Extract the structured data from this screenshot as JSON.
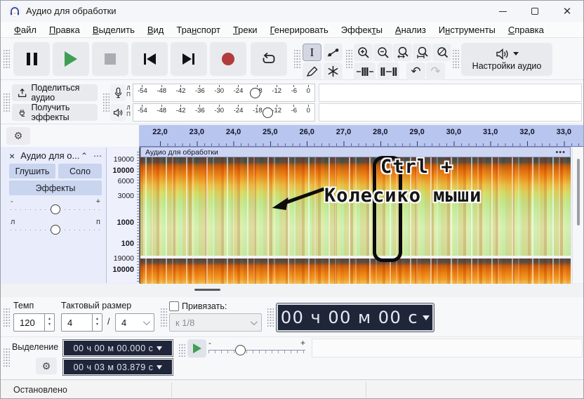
{
  "window": {
    "title": "Аудио для обработки"
  },
  "menu": {
    "items": [
      {
        "t": "Файл",
        "k": "Ф"
      },
      {
        "t": "Правка",
        "k": "П"
      },
      {
        "t": "Выделить",
        "k": "В"
      },
      {
        "t": "Вид",
        "k": "В"
      },
      {
        "t": "Транспорт",
        "k": "н"
      },
      {
        "t": "Треки",
        "k": "Т"
      },
      {
        "t": "Генерировать",
        "k": "Г"
      },
      {
        "t": "Эффекты",
        "k": "т"
      },
      {
        "t": "Анализ",
        "k": "А"
      },
      {
        "t": "Инструменты",
        "k": "н"
      },
      {
        "t": "Справка",
        "k": "С"
      }
    ]
  },
  "toolbar": {
    "audio_setup_label": "Настройки аудио",
    "share_label": "Поделиться аудио",
    "get_effects_label": "Получить эффекты"
  },
  "meters": {
    "scale": [
      "-54",
      "-48",
      "-42",
      "-36",
      "-30",
      "-24",
      "-18",
      "-12",
      "-6",
      "0"
    ],
    "channel_left": "Л",
    "channel_right": "П"
  },
  "timeline": {
    "labels": [
      "22,0",
      "23,0",
      "24,0",
      "25,0",
      "26,0",
      "27,0",
      "28,0",
      "29,0",
      "30,0",
      "31,0",
      "32,0",
      "33,0"
    ]
  },
  "track": {
    "panel_title": "Аудио для о...",
    "mute_label": "Глушить",
    "solo_label": "Соло",
    "effects_label": "Эффекты",
    "gain_min": "-",
    "gain_max": "+",
    "pan_left": "л",
    "pan_right": "п",
    "clip_title": "Аудио для обработки",
    "menu_dots": "•••",
    "freq_labels": [
      {
        "t": "19000",
        "b": false
      },
      {
        "t": "10000",
        "b": true
      },
      {
        "t": "6000",
        "b": false
      },
      {
        "t": "3000",
        "b": false
      },
      {
        "t": "1000",
        "b": true
      },
      {
        "t": "100",
        "b": true
      },
      {
        "t": "19000",
        "b": false
      },
      {
        "t": "10000",
        "b": true
      }
    ]
  },
  "annotation": {
    "line1": "Ctrl +",
    "line2": "Колесико мыши"
  },
  "time_toolbar": {
    "tempo_label": "Темп",
    "tempo_value": "120",
    "time_sig_label": "Тактовый размер",
    "time_sig_upper": "4",
    "time_sig_slash": "/",
    "time_sig_lower": "4",
    "snap_label": "Привязать:",
    "snap_value": "к 1/8",
    "time_display": "00 ч 00 м 00 с"
  },
  "selection": {
    "label": "Выделение",
    "start": "00 ч 00 м 00.000 с",
    "end": "00 ч 03 м 03.879 с",
    "speed_minus": "-",
    "speed_plus": "+"
  },
  "status": {
    "text": "Остановлено"
  },
  "colors": {
    "ruler_blue": "#b7c5ef",
    "display_dark": "#20263a",
    "play_green": "#3f9e54",
    "record_red": "#b23b3b"
  }
}
